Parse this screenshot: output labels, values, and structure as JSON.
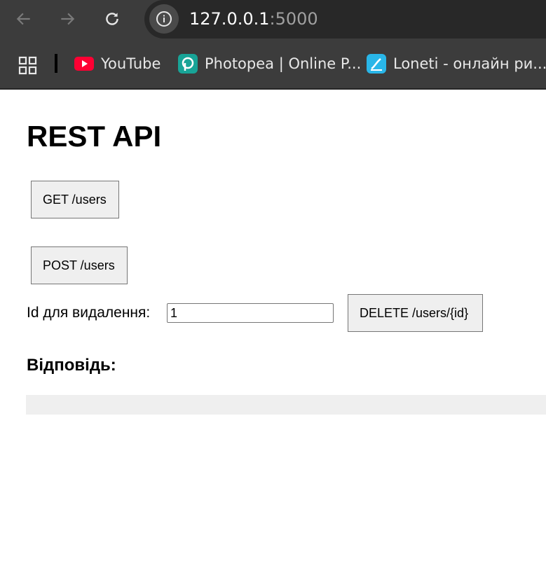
{
  "browser": {
    "url_host": "127.0.0.1",
    "url_port": ":5000",
    "bookmarks": [
      {
        "label": "YouTube",
        "icon": "youtube-icon"
      },
      {
        "label": "Photopea | Online P...",
        "icon": "photopea-icon"
      },
      {
        "label": "Loneti - онлайн ри...",
        "icon": "loneti-icon"
      }
    ]
  },
  "page": {
    "title": "REST API",
    "get_button": "GET /users",
    "post_button": "POST /users",
    "id_label": "Id для видалення:",
    "id_value": "1",
    "delete_button": "DELETE /users/{id}",
    "response_heading": "Відповідь:",
    "response_text": ""
  }
}
